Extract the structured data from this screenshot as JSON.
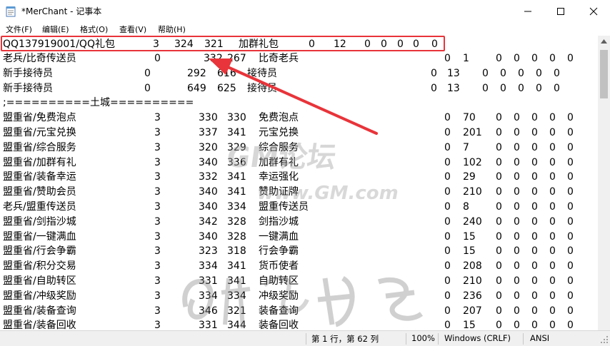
{
  "window": {
    "title": "*MerChant - 记事本"
  },
  "colors": {
    "highlight_border": "#e8343a",
    "arrow": "#e8343a"
  },
  "menu": [
    "文件(F)",
    "编辑(E)",
    "格式(O)",
    "查看(V)",
    "帮助(H)"
  ],
  "lines": [
    [
      "QQ137919001/QQ礼包",
      "3",
      "324",
      "321",
      "加群礼包",
      "0",
      "12",
      "0",
      "0",
      "0",
      "0",
      "0"
    ],
    [
      "老兵/比奇传送员",
      "0",
      "332",
      "267",
      "比奇老兵",
      "0",
      "1",
      "0",
      "0",
      "0",
      "0",
      "0"
    ],
    [
      "新手接待员",
      "0",
      "292",
      "616",
      "接待员",
      "0",
      "13",
      "0",
      "0",
      "0",
      "0",
      "0"
    ],
    [
      "新手接待员",
      "0",
      "649",
      "625",
      "接待员",
      "0",
      "13",
      "0",
      "0",
      "0",
      "0",
      "0"
    ],
    [
      ";==========土城=========="
    ],
    [
      "盟重省/免费泡点",
      "3",
      "330",
      "330",
      "免费泡点",
      "0",
      "70",
      "0",
      "0",
      "0",
      "0",
      "0"
    ],
    [
      "盟重省/元宝兑换",
      "3",
      "337",
      "341",
      "元宝兑换",
      "0",
      "201",
      "0",
      "0",
      "0",
      "0",
      "0"
    ],
    [
      "盟重省/综合服务",
      "3",
      "320",
      "329",
      "综合服务",
      "0",
      "7",
      "0",
      "0",
      "0",
      "0",
      "0"
    ],
    [
      "盟重省/加群有礼",
      "3",
      "340",
      "336",
      "加群有礼",
      "0",
      "102",
      "0",
      "0",
      "0",
      "0",
      "0"
    ],
    [
      "盟重省/装备幸运",
      "3",
      "332",
      "341",
      "幸运强化",
      "0",
      "29",
      "0",
      "0",
      "0",
      "0",
      "0"
    ],
    [
      "盟重省/赞助会员",
      "3",
      "340",
      "341",
      "赞助证牌",
      "0",
      "210",
      "0",
      "0",
      "0",
      "0",
      "0"
    ],
    [
      "老兵/盟重传送员",
      "3",
      "340",
      "334",
      "盟重传送员",
      "0",
      "8",
      "0",
      "0",
      "0",
      "0",
      "0"
    ],
    [
      "盟重省/剑指沙城",
      "3",
      "342",
      "328",
      "剑指沙城",
      "0",
      "240",
      "0",
      "0",
      "0",
      "0",
      "0"
    ],
    [
      "盟重省/一键满血",
      "3",
      "340",
      "328",
      "一键满血",
      "0",
      "15",
      "0",
      "0",
      "0",
      "0",
      "0"
    ],
    [
      "盟重省/行会争霸",
      "3",
      "323",
      "318",
      "行会争霸",
      "0",
      "15",
      "0",
      "0",
      "0",
      "0",
      "0"
    ],
    [
      "盟重省/积分交易",
      "3",
      "334",
      "341",
      "货币使者",
      "0",
      "208",
      "0",
      "0",
      "0",
      "0",
      "0"
    ],
    [
      "盟重省/自助转区",
      "3",
      "331",
      "341",
      "自助转区",
      "0",
      "210",
      "0",
      "0",
      "0",
      "0",
      "0"
    ],
    [
      "盟重省/冲级奖励",
      "3",
      "334",
      "334",
      "冲级奖励",
      "0",
      "236",
      "0",
      "0",
      "0",
      "0",
      "0"
    ],
    [
      "盟重省/装备查询",
      "3",
      "346",
      "321",
      "装备查询",
      "0",
      "207",
      "0",
      "0",
      "0",
      "0",
      "0"
    ],
    [
      "盟重省/装备回收",
      "3",
      "331",
      "344",
      "装备回收",
      "0",
      "15",
      "0",
      "0",
      "0",
      "0",
      "0"
    ]
  ],
  "watermarks": {
    "forum": "GM论坛",
    "url": "www.GM.com"
  },
  "status": {
    "position": "第 1 行，第 62 列",
    "zoom": "100%",
    "line_ending": "Windows (CRLF)",
    "encoding": "ANSI"
  }
}
